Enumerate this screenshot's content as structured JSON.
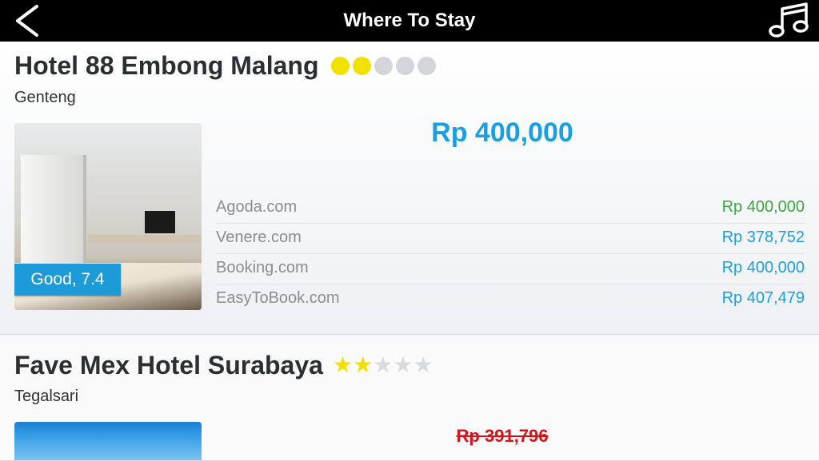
{
  "header": {
    "title": "Where To Stay",
    "back_icon": "chevron-left-icon",
    "music_icon": "music-note-icon"
  },
  "hotels": [
    {
      "name": "Hotel 88 Embong Malang",
      "area": "Genteng",
      "rating_style": "dots",
      "rating": 2,
      "rating_max": 5,
      "score_label": "Good, 7.4",
      "main_price": "Rp 400,000",
      "providers": [
        {
          "name": "Agoda.com",
          "price": "Rp 400,000",
          "color": "#39a83c"
        },
        {
          "name": "Venere.com",
          "price": "Rp 378,752",
          "color": "#1aa0e0"
        },
        {
          "name": "Booking.com",
          "price": "Rp 400,000",
          "color": "#1aa0e0"
        },
        {
          "name": "EasyToBook.com",
          "price": "Rp 407,479",
          "color": "#1aa0e0"
        }
      ]
    },
    {
      "name": "Fave Mex Hotel Surabaya",
      "area": "Tegalsari",
      "rating_style": "stars",
      "rating": 2,
      "rating_max": 5,
      "old_price": "Rp 391,796"
    }
  ],
  "colors": {
    "accent_blue": "#1aa0e0",
    "deal_green": "#39a83c",
    "strike_red": "#d0161c",
    "rating_yellow": "#f2e100"
  }
}
